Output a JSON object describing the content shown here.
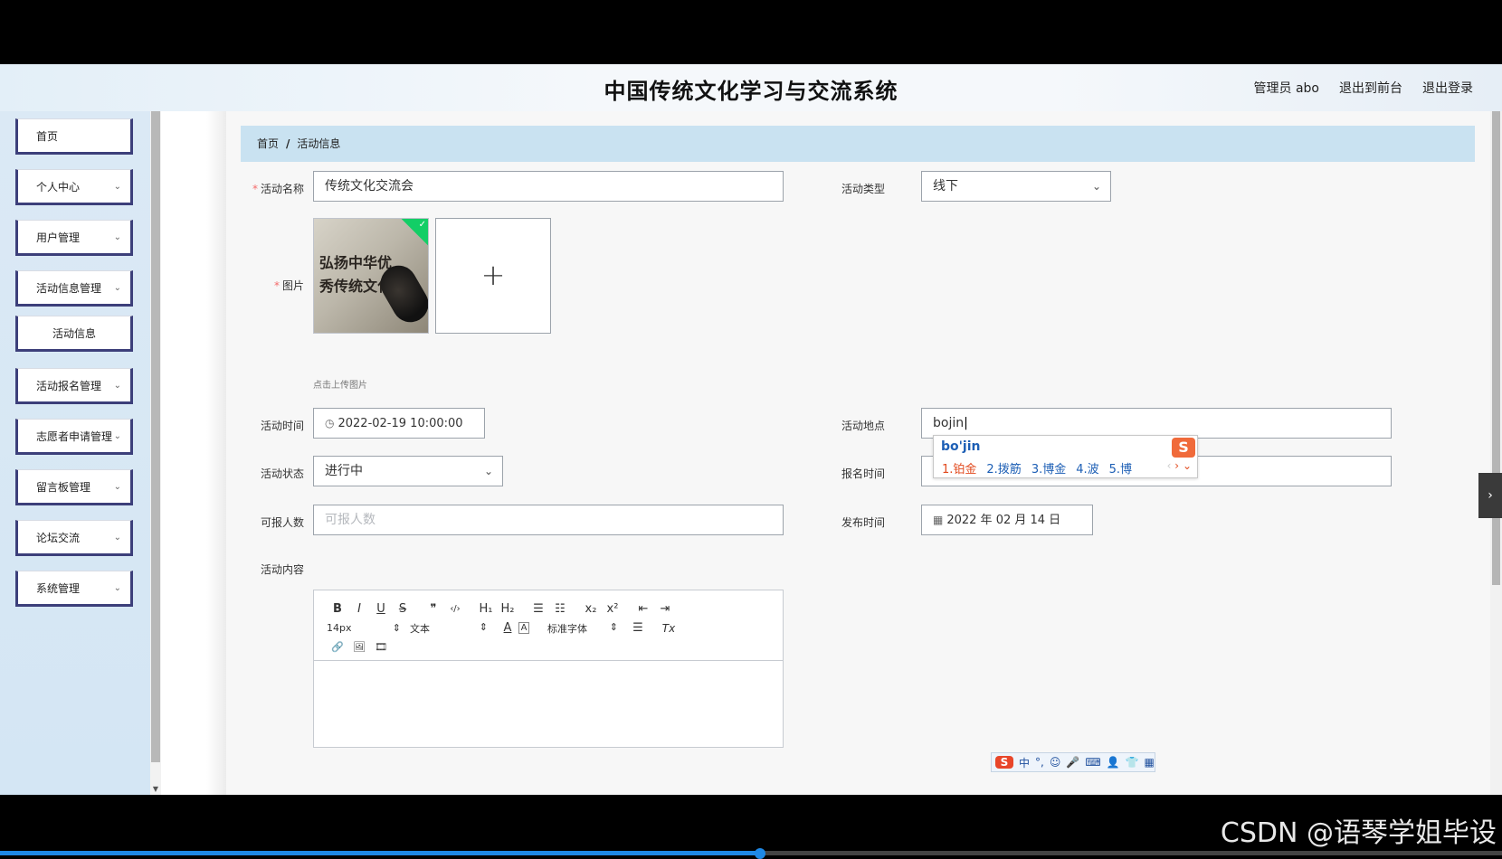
{
  "header": {
    "title": "中国传统文化学习与交流系统",
    "admin": "管理员 abo",
    "to_front": "退出到前台",
    "logout": "退出登录"
  },
  "sidebar": {
    "items": [
      {
        "label": "首页"
      },
      {
        "label": "个人中心"
      },
      {
        "label": "用户管理"
      },
      {
        "label": "活动信息管理"
      },
      {
        "label": "活动信息"
      },
      {
        "label": "活动报名管理"
      },
      {
        "label": "志愿者申请管理"
      },
      {
        "label": "留言板管理"
      },
      {
        "label": "论坛交流"
      },
      {
        "label": "系统管理"
      }
    ]
  },
  "breadcrumb": {
    "home": "首页",
    "sep": "/",
    "current": "活动信息"
  },
  "form": {
    "name_label": "活动名称",
    "name_value": "传统文化交流会",
    "type_label": "活动类型",
    "type_value": "线下",
    "image_label": "图片",
    "image_calligraphy": "弘扬中华优秀传统文化",
    "upload_hint": "点击上传图片",
    "time_label": "活动时间",
    "time_value": "2022-02-19 10:00:00",
    "place_label": "活动地点",
    "place_value": "bojin",
    "status_label": "活动状态",
    "status_value": "进行中",
    "signup_time_label": "报名时间",
    "signup_time_placeholder": "报名时间",
    "capacity_label": "可报人数",
    "capacity_placeholder": "可报人数",
    "publish_label": "发布时间",
    "publish_value": "2022 年 02 月 14 日",
    "content_label": "活动内容"
  },
  "editor": {
    "row1": [
      "B",
      "I",
      "U",
      "S",
      "❞",
      "‹/›",
      "H₁",
      "H₂",
      "☰",
      "☷",
      "x₂",
      "x²",
      "⇤",
      "⇥"
    ],
    "font_size": "14px",
    "heading": "文本",
    "font": "标准字体",
    "color": "A",
    "bg": "A",
    "align": "☰",
    "clear": "Tx",
    "row3": [
      "🔗",
      "🖼",
      "🎞"
    ]
  },
  "ime": {
    "pinyin": "bo'jin",
    "candidates": [
      "1.铂金",
      "2.拨筋",
      "3.博金",
      "4.波",
      "5.博"
    ],
    "logo": "S",
    "bar": [
      "中",
      "°,",
      "☺",
      "🎤",
      "⌨",
      "👤",
      "👕",
      "▦"
    ]
  },
  "watermark": "CSDN @语琴学姐毕设",
  "video": {
    "progress": 0.506
  }
}
